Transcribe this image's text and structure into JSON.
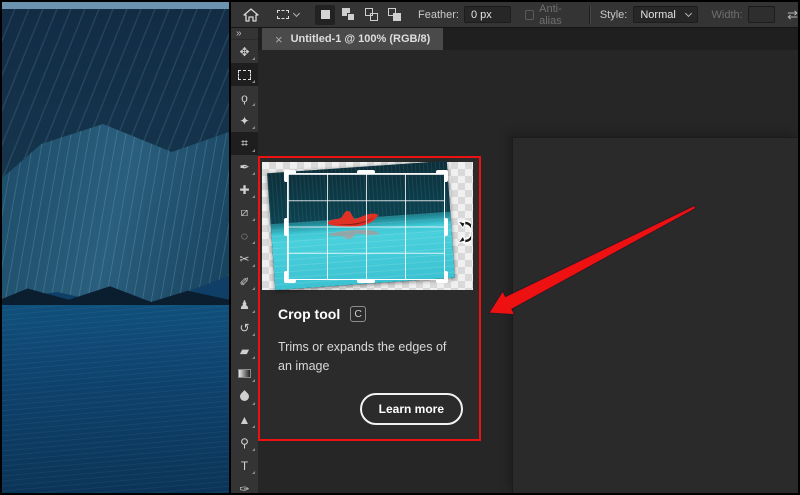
{
  "options_bar": {
    "feather_label": "Feather:",
    "feather_value": "0 px",
    "anti_alias_label": "Anti-alias",
    "style_label": "Style:",
    "style_value": "Normal",
    "width_label": "Width:",
    "transfer_glyph": "⇄"
  },
  "tab_bar": {
    "close_glyph": "×",
    "title": "Untitled-1 @ 100% (RGB/8)"
  },
  "tools_panel": {
    "collapse_glyph": "»",
    "tools": [
      {
        "name": "move",
        "glyph": "✥",
        "active": false
      },
      {
        "name": "rectangular-marquee",
        "glyph": "",
        "active": true
      },
      {
        "name": "lasso",
        "glyph": "ϙ",
        "active": false
      },
      {
        "name": "magic-wand",
        "glyph": "✦",
        "active": false
      },
      {
        "name": "crop",
        "glyph": "⌗",
        "active": true
      },
      {
        "name": "eyedropper",
        "glyph": "✒",
        "active": false
      },
      {
        "name": "spot-healing-brush",
        "glyph": "✚",
        "active": false
      },
      {
        "name": "healing-brush",
        "glyph": "⧄",
        "active": false
      },
      {
        "name": "patch",
        "glyph": "◌",
        "active": false
      },
      {
        "name": "content-aware-move",
        "glyph": "✂",
        "active": false
      },
      {
        "name": "brush",
        "glyph": "✐",
        "active": false
      },
      {
        "name": "clone-stamp",
        "glyph": "♟",
        "active": false
      },
      {
        "name": "history-brush",
        "glyph": "↺",
        "active": false
      },
      {
        "name": "eraser",
        "glyph": "▰",
        "active": false
      },
      {
        "name": "gradient",
        "glyph": "",
        "active": false
      },
      {
        "name": "blur",
        "glyph": "",
        "active": false
      },
      {
        "name": "sharpen",
        "glyph": "▲",
        "active": false
      },
      {
        "name": "dodge",
        "glyph": "⚲",
        "active": false
      },
      {
        "name": "type",
        "glyph": "T",
        "active": false
      },
      {
        "name": "pen",
        "glyph": "✑",
        "active": false
      }
    ]
  },
  "tooltip": {
    "title": "Crop tool",
    "shortcut_key": "C",
    "description": "Trims or expands the edges of an image",
    "learn_more_label": "Learn more"
  },
  "colors": {
    "accent_red": "#ee1111",
    "water_turquoise": "#3cc7d5",
    "water_dark": "#0b3b48",
    "canoe_red": "#e03127",
    "panel_dark": "#343434",
    "canvas_dark": "#262626",
    "tooltip_bg": "#2b2b2b",
    "active_tab_bg": "#4a4a4a"
  }
}
